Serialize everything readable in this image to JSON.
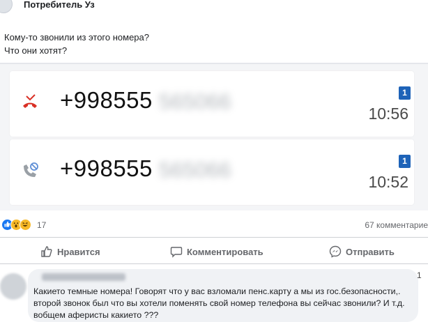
{
  "group": {
    "name": "Потребитель Уз"
  },
  "post": {
    "lines": [
      "Кому-то звонили из этого номера?",
      "Что они хотят?"
    ]
  },
  "calls": [
    {
      "number": "+998555",
      "hidden": "565066",
      "sim": "1",
      "time": "10:56",
      "icon": "missed-call-icon"
    },
    {
      "number": "+998555",
      "hidden": "565066",
      "sim": "1",
      "time": "10:52",
      "icon": "blocked-call-icon"
    }
  ],
  "reactions": {
    "count": "17",
    "comments": "67 комментарие",
    "icons": [
      "like-reaction-icon",
      "wow-reaction-icon",
      "haha-reaction-icon"
    ]
  },
  "actions": {
    "like": "Нравится",
    "comment": "Комментировать",
    "share": "Отправить"
  },
  "comment": {
    "text": "Какието темные номера! Говорят что у вас взломали пенс.карту а мы из гос.безопасности,. второй звонок был что вы хотели поменять свой номер телефона вы сейчас звонили? И т.д. вобщем аферисты какието ???",
    "more": "1"
  },
  "colors": {
    "accent": "#1877f2",
    "missed": "#d93025",
    "sim": "#1e63b8",
    "muted": "#65676b"
  }
}
